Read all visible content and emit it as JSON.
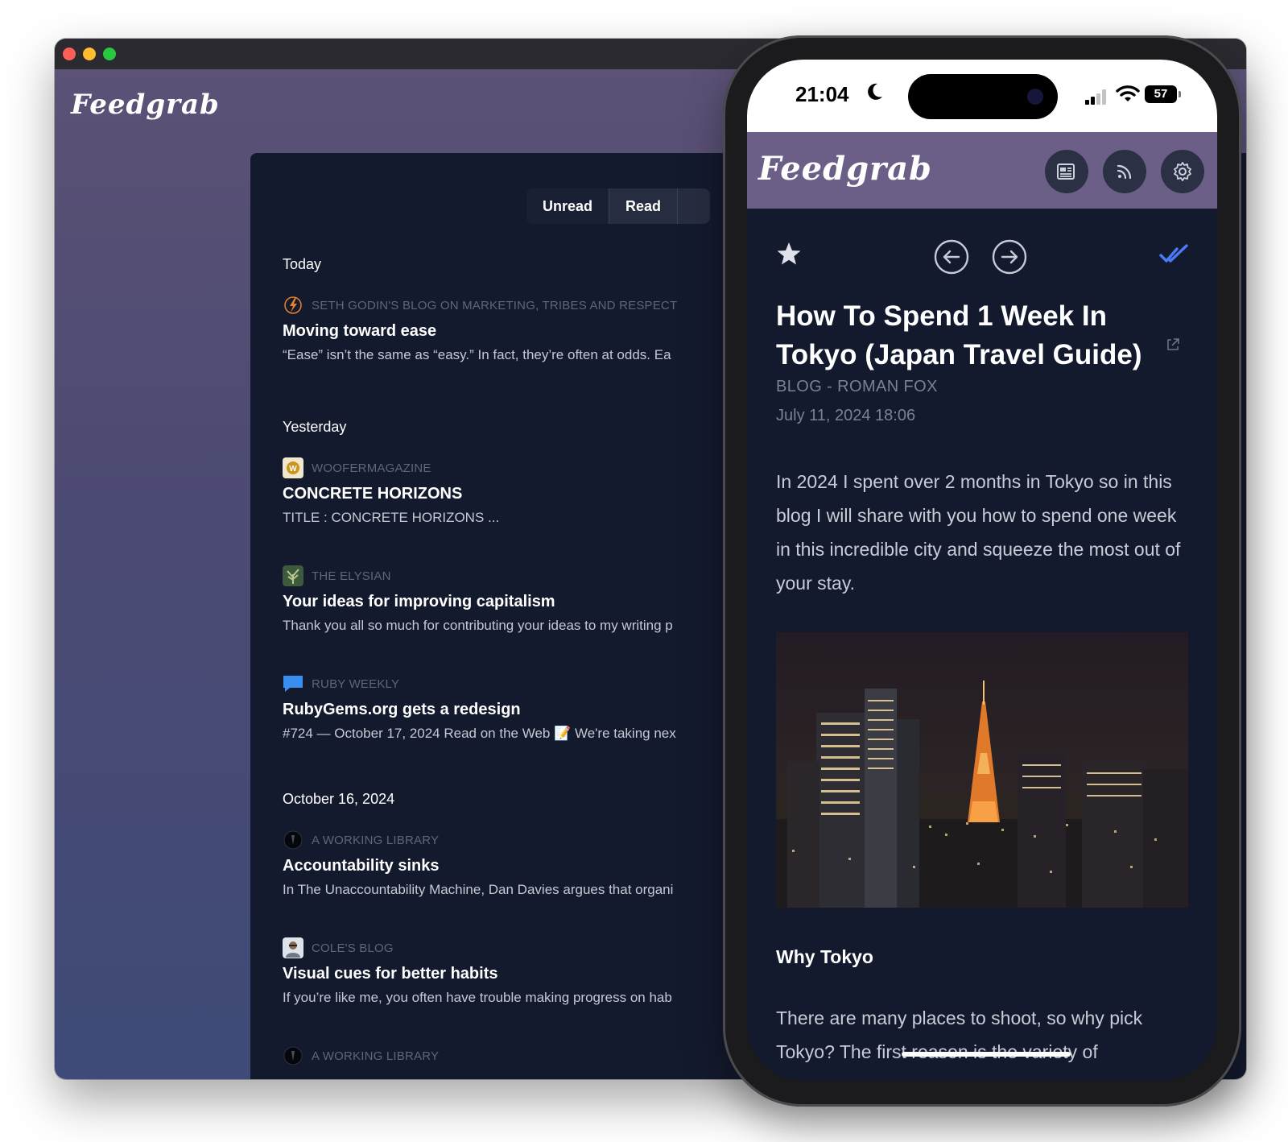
{
  "desktop": {
    "logo": "Feedgrab",
    "tabs": [
      {
        "label": "Unread",
        "active": true
      },
      {
        "label": "Read",
        "active": false
      }
    ],
    "groups": [
      {
        "title": "Today",
        "entries": [
          {
            "source": "SETH GODIN'S BLOG ON MARKETING, TRIBES AND RESPECT",
            "icon": "seth-godin-bolt-icon",
            "title": "Moving toward ease",
            "snippet": "“Ease” isn’t the same as “easy.” In fact, they’re often at odds. Ea"
          }
        ]
      },
      {
        "title": "Yesterday",
        "entries": [
          {
            "source": "WOOFERMAGAZINE",
            "icon": "woofer-w-icon",
            "title": "CONCRETE HORIZONS",
            "snippet": "TITLE : CONCRETE HORIZONS ..."
          },
          {
            "source": "THE ELYSIAN",
            "icon": "elysian-plant-icon",
            "title": "Your ideas for improving capitalism",
            "snippet": "Thank you all so much for contributing your ideas to my writing p"
          },
          {
            "source": "RUBY WEEKLY",
            "icon": "ruby-weekly-chat-icon",
            "title": "RubyGems.org gets a redesign",
            "snippet": "#724 — October 17, 2024 Read on the Web 📝 We're taking nex"
          }
        ]
      },
      {
        "title": "October 16, 2024",
        "entries": [
          {
            "source": "A WORKING LIBRARY",
            "icon": "working-library-icon",
            "title": "Accountability sinks",
            "snippet": "In The Unaccountability Machine, Dan Davies argues that organi"
          },
          {
            "source": "COLE'S BLOG",
            "icon": "cole-avatar-icon",
            "title": "Visual cues for better habits",
            "snippet": "If you’re like me, you often have trouble making progress on hab"
          },
          {
            "source": "A WORKING LIBRARY",
            "icon": "working-library-icon",
            "title": "",
            "snippet": ""
          }
        ]
      }
    ]
  },
  "phone": {
    "status": {
      "time": "21:04",
      "battery": "57"
    },
    "logo": "Feedgrab",
    "header_icons": [
      "newspaper-icon",
      "rss-icon",
      "gear-icon"
    ],
    "article": {
      "title": "How To Spend 1 Week In Tokyo (Japan Travel Guide)",
      "source": "BLOG - ROMAN FOX",
      "date": "July 11, 2024 18:06",
      "lead": "In 2024 I spent over 2 months in Tokyo so in this blog I will share with you how to spend one week in this incredible city and squeeze the most out of your stay.",
      "section_heading": "Why Tokyo",
      "body": "There are many places to shoot, so why pick Tokyo? The first reason is the variety of"
    }
  },
  "colors": {
    "panel": "#141a2e",
    "phone_header": "#6b5f87",
    "accent_check": "#4a7bf7"
  }
}
